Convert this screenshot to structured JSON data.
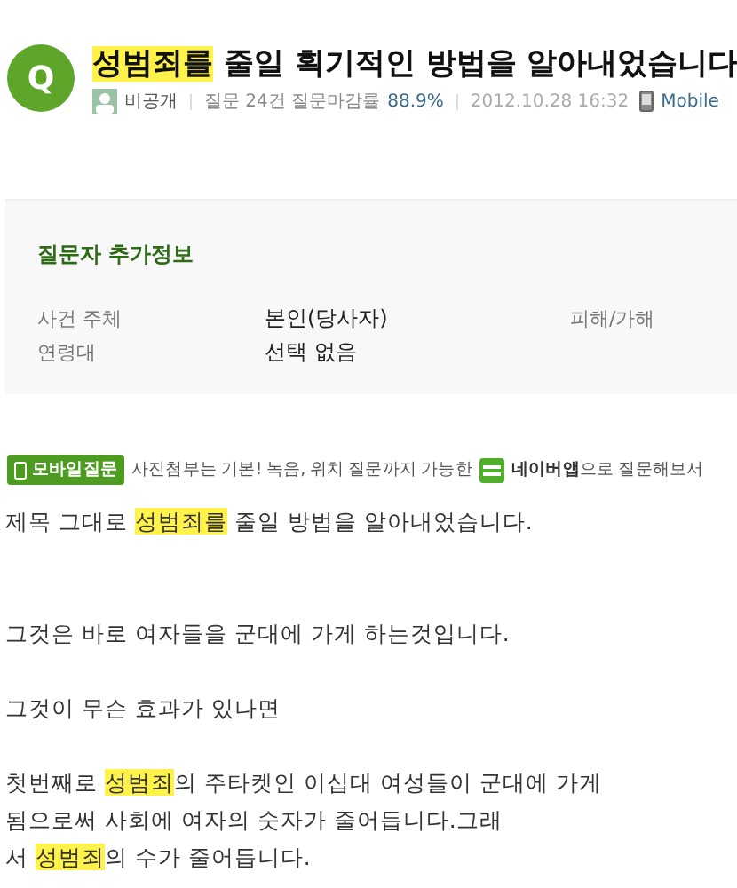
{
  "question": {
    "badge": "Q",
    "title": [
      {
        "text": "성범죄를",
        "highlight": true
      },
      {
        "text": " 줄일 획기적인 방법을 알아내었습니다",
        "highlight": false
      }
    ],
    "author": "비공개",
    "stats_label": "질문 24건 질문마감률",
    "close_rate": "88.9%",
    "date": "2012.10.28 16:32",
    "device": "Mobile"
  },
  "extra_info": {
    "heading": "질문자 추가정보",
    "rows": [
      {
        "label": "사건 주체",
        "value": "본인(당사자)",
        "column_3": "피해/가해"
      },
      {
        "label": "연령대",
        "value": "선택 없음"
      }
    ]
  },
  "mobile_banner": {
    "tag": "모바일질문",
    "text": "사진첨부는 기본! 녹음, 위치 질문까지 가능한",
    "app": "네이버앱",
    "suffix": "으로 질문해보서"
  },
  "body": [
    {
      "lines": [
        [
          {
            "text": "제목 그대로 ",
            "highlight": false
          },
          {
            "text": "성범죄를",
            "highlight": true
          },
          {
            "text": " 줄일 방법을 알아내었습니다.",
            "highlight": false
          }
        ]
      ]
    },
    {
      "lines": [
        [
          {
            "text": "그것은 바로 여자들을 군대에 가게 하는것입니다.",
            "highlight": false
          }
        ]
      ]
    },
    {
      "lines": [
        [
          {
            "text": "그것이 무슨 효과가 있나면",
            "highlight": false
          }
        ]
      ]
    },
    {
      "lines": [
        [
          {
            "text": "첫번째로 ",
            "highlight": false
          },
          {
            "text": "성범죄",
            "highlight": true
          },
          {
            "text": "의 주타켓인 이십대 여성들이 군대에 가게",
            "highlight": false
          }
        ],
        [
          {
            "text": "됨으로써 사회에 여자의 숫자가 줄어듭니다.그래",
            "highlight": false
          }
        ],
        [
          {
            "text": "서 ",
            "highlight": false
          },
          {
            "text": "성범죄",
            "highlight": true
          },
          {
            "text": "의 수가 줄어듭니다.",
            "highlight": false
          }
        ]
      ]
    }
  ]
}
